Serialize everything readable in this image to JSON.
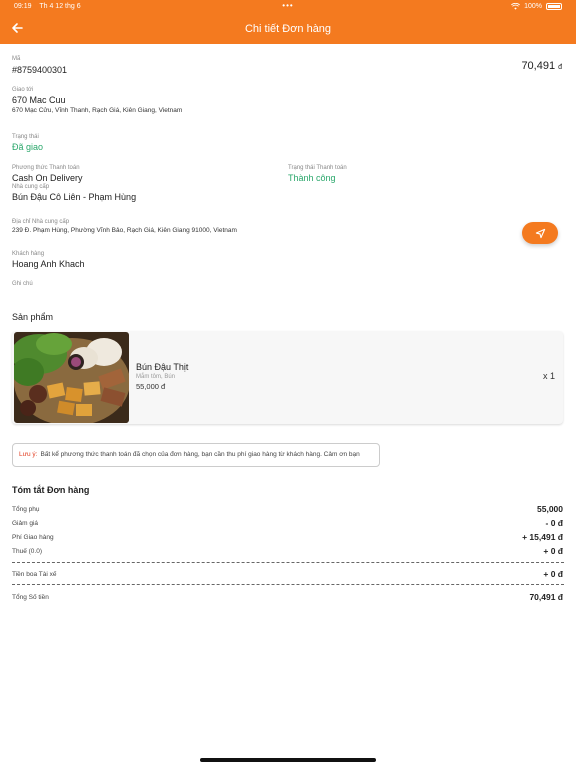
{
  "status_bar": {
    "time": "09:19",
    "date": "Th 4 12 thg 6",
    "battery": "100%"
  },
  "header": {
    "title": "Chi tiết Đơn hàng"
  },
  "order": {
    "code_label": "Mã",
    "code": "#8759400301",
    "amount": "70,491",
    "currency": "đ",
    "deliver_label": "Giao tới",
    "deliver_name": "670 Mac Cuu",
    "deliver_address": "670 Mạc Cửu, Vĩnh Thanh, Rạch Giá, Kiên Giang, Vietnam",
    "status_label": "Trạng thái",
    "status": "Đã giao",
    "payment_method_label": "Phương thức Thanh toán",
    "payment_method": "Cash On Delivery",
    "payment_status_label": "Trạng thái Thanh toán",
    "payment_status": "Thành công",
    "supplier_label": "Nhà cung cấp",
    "supplier": "Bún Đậu Cô Liên - Phạm Hùng",
    "supplier_address_label": "Địa chỉ Nhà cung cấp",
    "supplier_address": "239 Đ. Phạm Hùng, Phường Vĩnh Bảo, Rạch Giá, Kiên Giang 91000, Vietnam",
    "customer_label": "Khách hàng",
    "customer": "Hoang Anh Khach",
    "note_label": "Ghi chú"
  },
  "products": {
    "section_title": "Sản phẩm",
    "items": [
      {
        "name": "Bún Đậu Thịt",
        "desc": "Mắm tôm, Bún",
        "price": "55,000 đ",
        "qty": "x 1"
      }
    ]
  },
  "notice": {
    "label": "Lưu ý:",
    "text": "Bất kể phương thức thanh toán đã chọn của đơn hàng, bạn cần thu phí giao hàng từ khách hàng. Cảm ơn bạn"
  },
  "summary": {
    "title": "Tóm tắt Đơn hàng",
    "rows": [
      {
        "label": "Tổng phụ",
        "value": "55,000"
      },
      {
        "label": "Giảm giá",
        "value": "- 0 đ"
      },
      {
        "label": "Phí Giao hàng",
        "value": "+ 15,491 đ"
      },
      {
        "label": "Thuế (0.0)",
        "value": "+ 0 đ"
      }
    ],
    "tip_label": "Tiền boa Tài xế",
    "tip_value": "+ 0 đ",
    "total_label": "Tổng Số tiền",
    "total_value": "70,491 đ"
  },
  "colors": {
    "accent": "#f47a1f",
    "success": "#2aa76b",
    "notice": "#e23c1f"
  }
}
